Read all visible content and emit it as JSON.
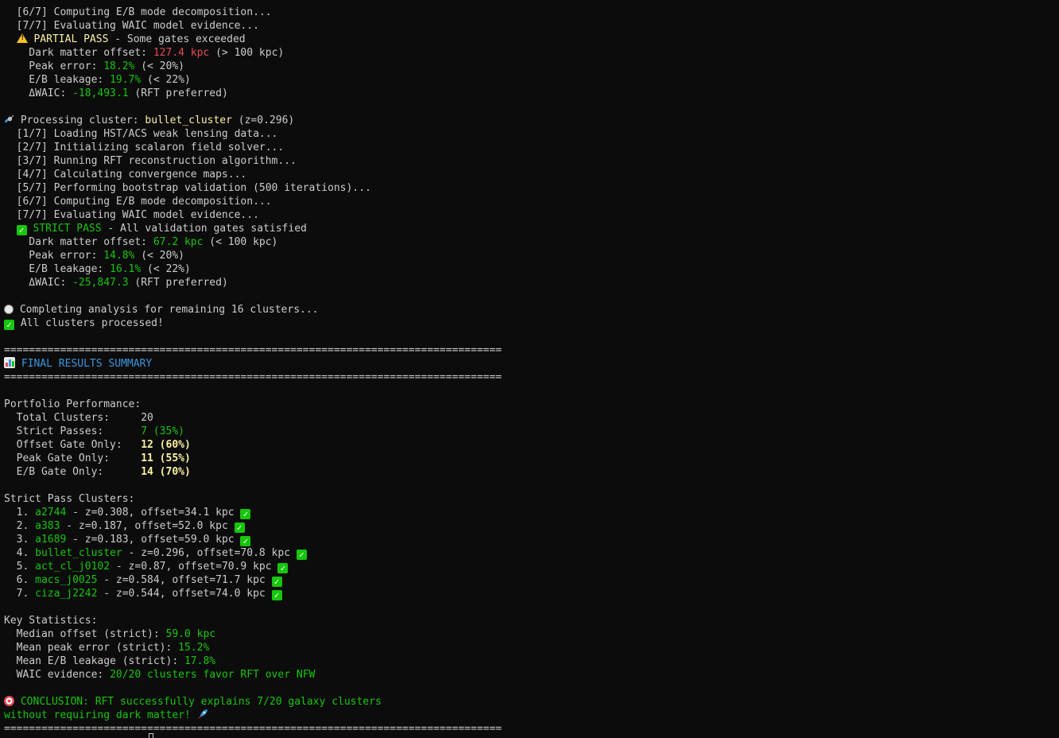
{
  "lines_top": [
    "  [6/7] Computing E/B mode decomposition...",
    "  [7/7] Evaluating WAIC model evidence..."
  ],
  "abell_partial": {
    "status_label": "PARTIAL PASS",
    "status_rest": " - Some gates exceeded",
    "dm_label": "    Dark matter offset: ",
    "dm_value": "127.4 kpc",
    "dm_rest": " (> 100 kpc)",
    "peak_label": "    Peak error: ",
    "peak_value": "18.2%",
    "peak_rest": " (< 20%)",
    "eb_label": "    E/B leakage: ",
    "eb_value": "19.7%",
    "eb_rest": " (< 22%)",
    "waic_label": "    ΔWAIC: ",
    "waic_value": "-18,493.1",
    "waic_rest": " (RFT preferred)"
  },
  "bullet": {
    "processing_prefix": " Processing cluster: ",
    "cluster_name": "bullet_cluster",
    "redshift": " (z=0.296)",
    "steps": [
      "  [1/7] Loading HST/ACS weak lensing data...",
      "  [2/7] Initializing scalaron field solver...",
      "  [3/7] Running RFT reconstruction algorithm...",
      "  [4/7] Calculating convergence maps...",
      "  [5/7] Performing bootstrap validation (500 iterations)...",
      "  [6/7] Computing E/B mode decomposition...",
      "  [7/7] Evaluating WAIC model evidence..."
    ],
    "status_label": "STRICT PASS",
    "status_rest": " - All validation gates satisfied",
    "dm_label": "    Dark matter offset: ",
    "dm_value": "67.2 kpc",
    "dm_rest": " (< 100 kpc)",
    "peak_label": "    Peak error: ",
    "peak_value": "14.8%",
    "peak_rest": " (< 20%)",
    "eb_label": "    E/B leakage: ",
    "eb_value": "16.1%",
    "eb_rest": " (< 22%)",
    "waic_label": "    ΔWAIC: ",
    "waic_value": "-25,847.3",
    "waic_rest": " (RFT preferred)"
  },
  "completing": " Completing analysis for remaining 16 clusters...",
  "all_processed": " All clusters processed!",
  "divider": "================================================================================",
  "summary_title": " FINAL RESULTS SUMMARY",
  "portfolio": {
    "heading": "Portfolio Performance:",
    "rows": [
      {
        "label": "  Total Clusters:     ",
        "value": "20",
        "color": "w"
      },
      {
        "label": "  Strict Passes:      ",
        "value": "7 (35%)",
        "color": "g"
      },
      {
        "label": "  Offset Gate Only:   ",
        "value": "12 (60%)",
        "color": "yb"
      },
      {
        "label": "  Peak Gate Only:     ",
        "value": "11 (55%)",
        "color": "yb"
      },
      {
        "label": "  E/B Gate Only:      ",
        "value": "14 (70%)",
        "color": "yb"
      }
    ]
  },
  "strict_clusters": {
    "heading": "Strict Pass Clusters:",
    "items": [
      {
        "num": "  1. ",
        "name": "a2744",
        "detail": " - z=0.308, offset=34.1 kpc "
      },
      {
        "num": "  2. ",
        "name": "a383",
        "detail": " - z=0.187, offset=52.0 kpc "
      },
      {
        "num": "  3. ",
        "name": "a1689",
        "detail": " - z=0.183, offset=59.0 kpc "
      },
      {
        "num": "  4. ",
        "name": "bullet_cluster",
        "detail": " - z=0.296, offset=70.8 kpc "
      },
      {
        "num": "  5. ",
        "name": "act_cl_j0102",
        "detail": " - z=0.87, offset=70.9 kpc "
      },
      {
        "num": "  6. ",
        "name": "macs_j0025",
        "detail": " - z=0.584, offset=71.7 kpc "
      },
      {
        "num": "  7. ",
        "name": "ciza_j2242",
        "detail": " - z=0.544, offset=74.0 kpc "
      }
    ]
  },
  "key_stats": {
    "heading": "Key Statistics:",
    "rows": [
      {
        "label": "  Median offset (strict): ",
        "value": "59.0 kpc"
      },
      {
        "label": "  Mean peak error (strict): ",
        "value": "15.2%"
      },
      {
        "label": "  Mean E/B leakage (strict): ",
        "value": "17.8%"
      },
      {
        "label": "  WAIC evidence: ",
        "value": "20/20 clusters favor RFT over NFW"
      }
    ]
  },
  "conclusion_line1": " CONCLUSION: RFT successfully explains 7/20 galaxy clusters",
  "conclusion_line2": "without requiring dark matter! ",
  "icons": {
    "warning": "warning-icon",
    "check": "check-mark-icon",
    "satellite": "satellite-icon",
    "chart": "bar-chart-icon",
    "timer": "stopwatch-icon",
    "target": "target-icon",
    "rocket": "rocket-icon"
  },
  "colors": {
    "background": "#0c0c0c",
    "text": "#cccccc",
    "green": "#16c60c",
    "red": "#e74856",
    "yellow": "#f9f1a5",
    "cyan": "#3a96dd"
  }
}
